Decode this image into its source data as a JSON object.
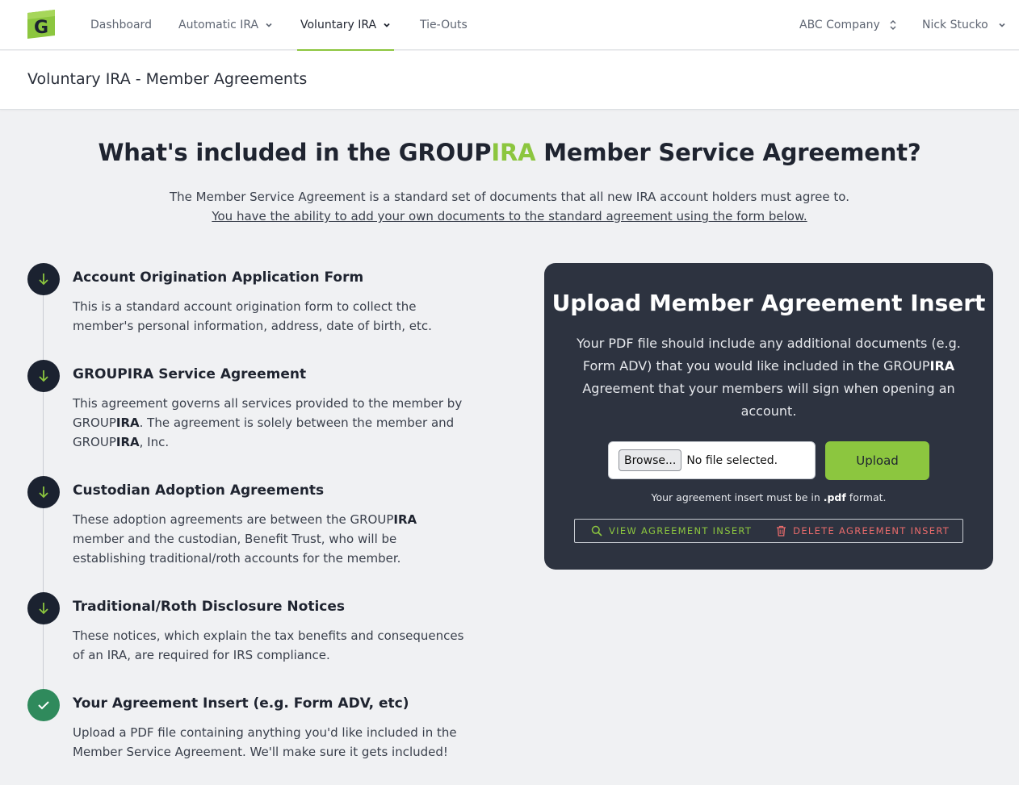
{
  "nav": {
    "brand_letter": "G",
    "items": [
      {
        "label": "Dashboard"
      },
      {
        "label": "Automatic IRA"
      },
      {
        "label": "Voluntary IRA"
      },
      {
        "label": "Tie-Outs"
      }
    ],
    "company": "ABC Company",
    "user": "Nick Stucko",
    "active_item": "Voluntary IRA"
  },
  "page": {
    "title": "Voluntary IRA - Member Agreements"
  },
  "hero": {
    "title_pre": "What's included in the GROUP",
    "title_accent": "IRA",
    "title_post": " Member Service Agreement?",
    "description": "The Member Service Agreement is a standard set of documents that all new IRA account holders must agree to.",
    "link": "You have the ability to add your own documents to the standard agreement using the form below."
  },
  "steps": [
    {
      "title": "Account Origination Application Form",
      "desc": "This is a standard account origination form to collect the member's personal information, address, date of birth, etc.",
      "status": "download"
    },
    {
      "title": "GROUPIRA Service Agreement",
      "desc_1": "This agreement governs all services provided to the member by GROUP",
      "desc_b1": "IRA",
      "desc_2": ". The agreement is solely between the member and GROUP",
      "desc_b2": "IRA",
      "desc_3": ", Inc.",
      "status": "download"
    },
    {
      "title": "Custodian Adoption Agreements",
      "desc_1": "These adoption agreements are between the GROUP",
      "desc_b1": "IRA",
      "desc_2": " member and the custodian, Benefit Trust, who will be establishing traditional/roth accounts for the member.",
      "status": "download"
    },
    {
      "title": "Traditional/Roth Disclosure Notices",
      "desc": "These notices, which explain the tax benefits and consequences of an IRA, are required for IRS compliance.",
      "status": "download"
    },
    {
      "title": "Your Agreement Insert (e.g. Form ADV, etc)",
      "desc": "Upload a PDF file containing anything you'd like included in the Member Service Agreement. We'll make sure it gets included!",
      "status": "complete"
    }
  ],
  "upload": {
    "title": "Upload Member Agreement Insert",
    "desc_1": "Your PDF file should include any additional documents (e.g. Form ADV) that you would like included in the GROUP",
    "desc_b": "IRA",
    "desc_2": " Agreement that your members will sign when opening an account.",
    "browse_label": "Browse...",
    "file_status": "No file selected.",
    "upload_label": "Upload",
    "format_pre": "Your agreement insert must be in ",
    "format_ext": ".pdf",
    "format_post": " format.",
    "view_label": "VIEW AGREEMENT INSERT",
    "delete_label": "DELETE AGREEMENT INSERT"
  },
  "colors": {
    "accent": "#8cc63f",
    "panel": "#2d3340",
    "danger": "#e96b6b",
    "success": "#2f8a5c",
    "icon_dark": "#1b2230"
  }
}
